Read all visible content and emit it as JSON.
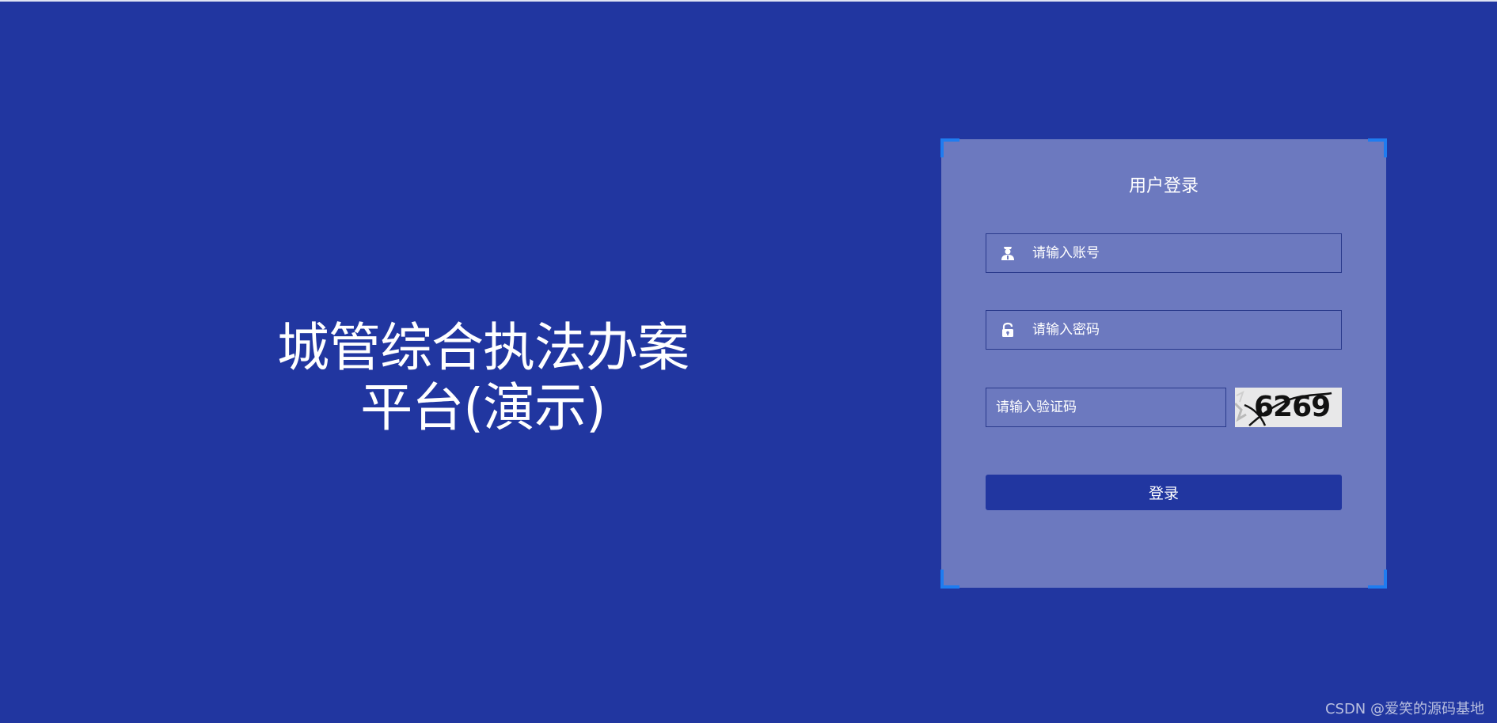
{
  "platform": {
    "title_line1": "城管综合执法办案",
    "title_line2": "平台(演示)"
  },
  "login": {
    "title": "用户登录",
    "username_placeholder": "请输入账号",
    "password_placeholder": "请输入密码",
    "captcha_placeholder": "请输入验证码",
    "captcha_code": "6269",
    "submit_label": "登录",
    "username_icon": "user-icon",
    "password_icon": "lock-icon"
  },
  "watermark": "CSDN @爱笑的源码基地",
  "colors": {
    "background": "#2136a0",
    "panel": "#6c79bf",
    "corner_accent": "#1f7cf0",
    "button": "#2136a0"
  }
}
